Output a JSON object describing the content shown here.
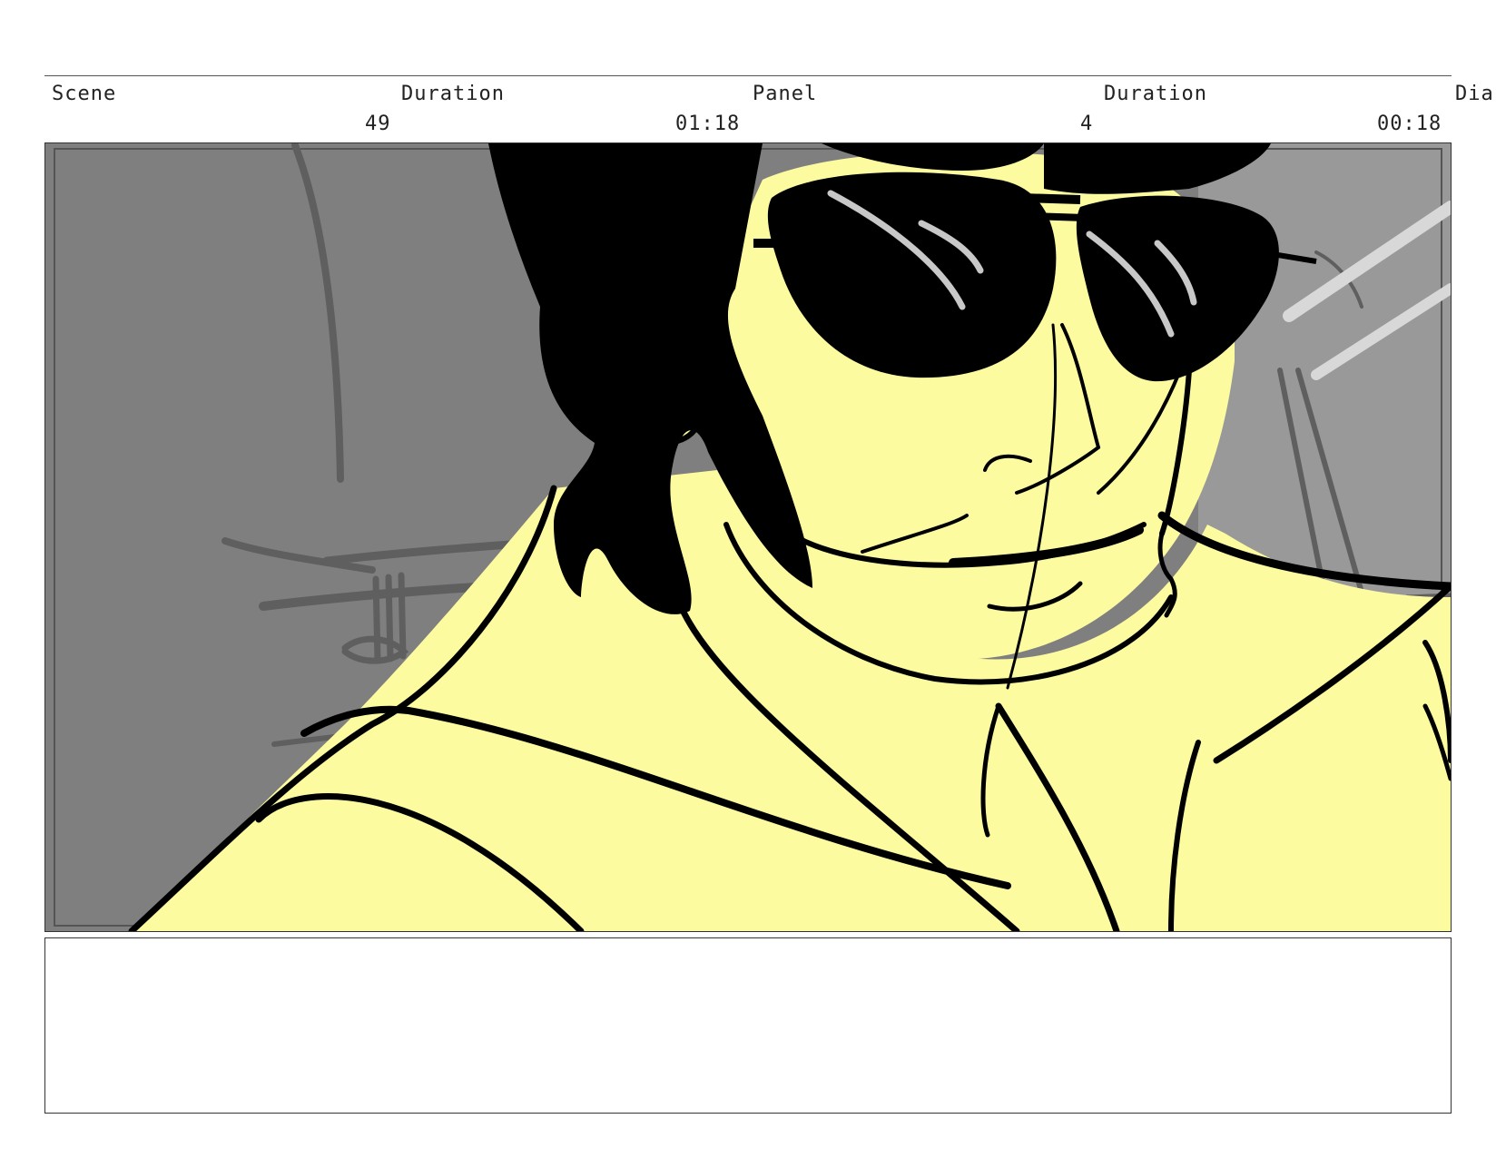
{
  "header": {
    "scene_label": "Scene",
    "duration_label": "Duration",
    "panel_label": "Panel",
    "panel_duration_label": "Duration",
    "dialogue_label": "Dia"
  },
  "values": {
    "scene_number": "49",
    "scene_duration": "01:18",
    "panel_number": "4",
    "panel_duration": "00:18"
  },
  "panel": {
    "background_color": "#7f7f7f",
    "right_bg_color": "#999999",
    "figure_fill_color": "#fdfb9f",
    "ink_color": "#000000"
  },
  "notes": {
    "text": ""
  }
}
